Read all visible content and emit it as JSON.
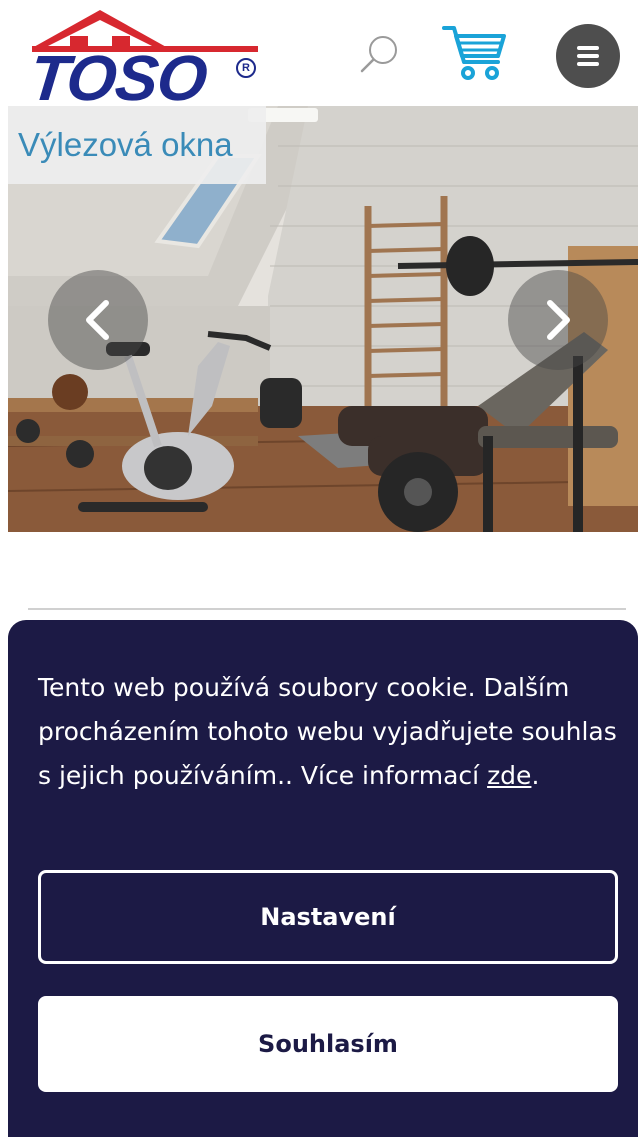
{
  "header": {
    "logo_text": "TOSO",
    "logo_reg_mark": "R",
    "icons": [
      "search-icon",
      "cart-icon",
      "menu-icon"
    ]
  },
  "hero": {
    "category_label": "Výlezová okna",
    "prev_icon": "chevron-left-icon",
    "next_icon": "chevron-right-icon",
    "image_description_icon": "attic-gym-photo"
  },
  "cookie_banner": {
    "text_before_link": "Tento web používá soubory cookie. Dalším procházením tohoto webu vyjadřujete souhlas s jejich používáním.. Více informací ",
    "link_text": "zde",
    "text_after_link": ".",
    "settings_label": "Nastavení",
    "agree_label": "Souhlasím"
  },
  "colors": {
    "brand_blue": "#1d2a8c",
    "roof_red": "#d7282f",
    "label_blue": "#3a8bb8",
    "cookie_bg": "#1c1a45",
    "cart_cyan": "#1aa3d8"
  }
}
